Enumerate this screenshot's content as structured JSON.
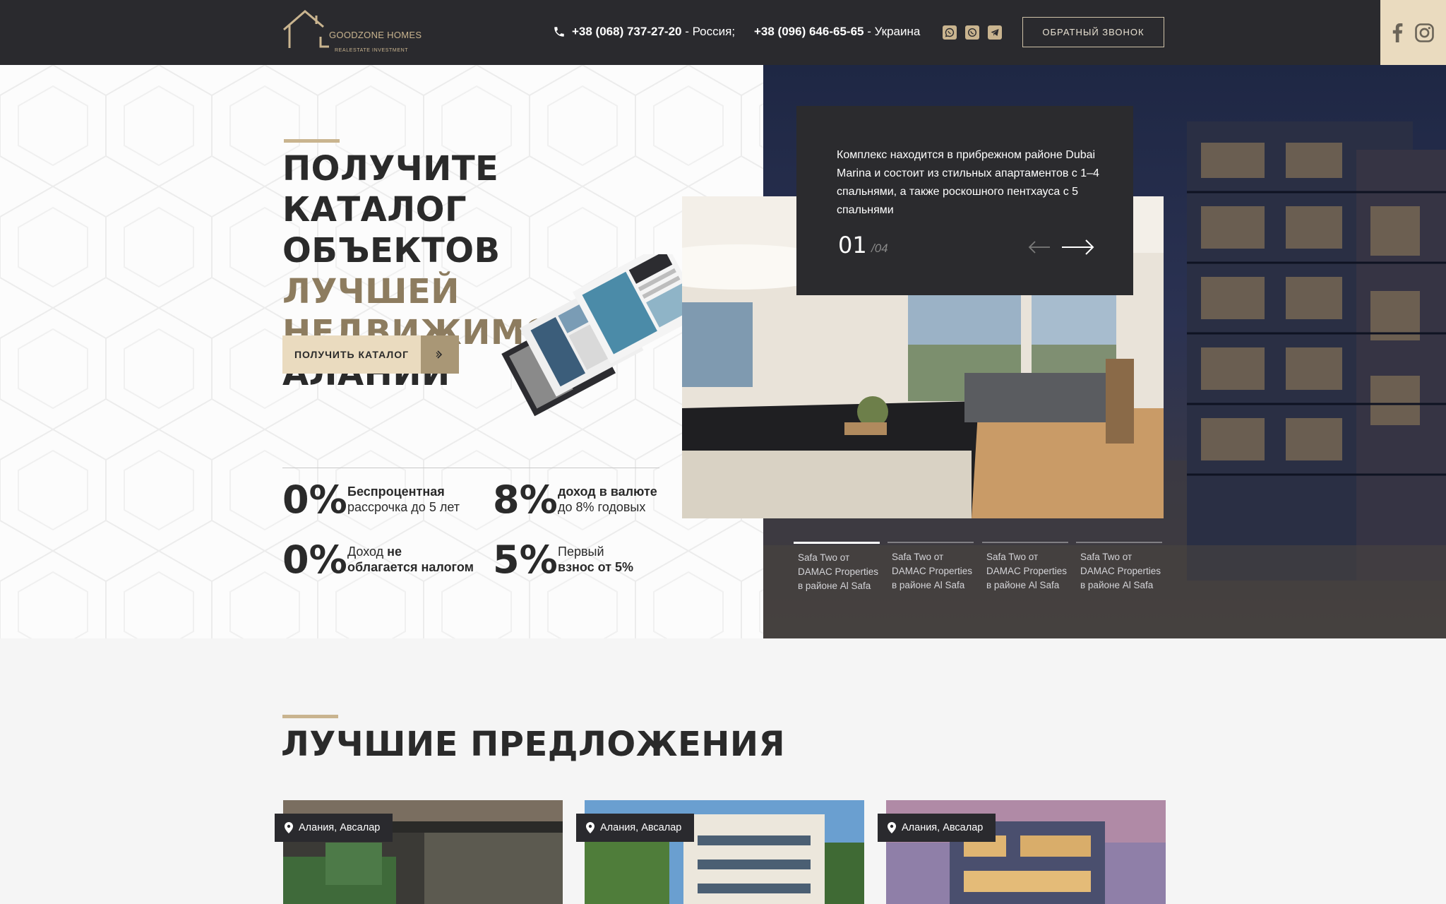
{
  "header": {
    "logo_name": "GOODZONE HOMES",
    "logo_sub": "REALESTATE INVESTMENT",
    "phone1": "+38 (068) 737-27-20",
    "phone1_suffix": " - Россия;",
    "phone2": "+38 (096) 646-65-65",
    "phone2_suffix": " - Украина",
    "messengers": [
      "viber-icon",
      "whatsapp-icon",
      "telegram-icon"
    ],
    "callback_label": "ОБРАТНЫЙ ЗВОНОК",
    "socials": [
      "facebook-icon",
      "instagram-icon"
    ]
  },
  "hero": {
    "title_line1": "ПОЛУЧИТЕ КАТАЛОГ",
    "title_line2a": "ОБЪЕКТОВ ",
    "title_line2b": "ЛУЧШЕЙ",
    "title_line3": "НЕДВИЖИМОСТИ",
    "title_line4": "АЛАНИИ",
    "catalog_button": "ПОЛУЧИТЬ КАТАЛОГ",
    "stats": [
      {
        "num": "0%",
        "line1": "Беспроцентная",
        "line2": "рассрочка до 5 лет"
      },
      {
        "num": "8%",
        "line1": "доход в валюте",
        "line2": "до 8% годовых"
      },
      {
        "num": "0%",
        "line1_a": "Доход ",
        "line1_b": "не",
        "line2": "облагается налогом"
      },
      {
        "num": "5%",
        "line1": "Первый",
        "line2": "взнос от 5%"
      }
    ]
  },
  "slider": {
    "description": "Комплекс находится в прибрежном районе Dubai Marina и состоит из стильных апартаментов с 1–4 спальнями, а также роскошного пентхауса с 5 спальнями",
    "current": "01",
    "total": "/04",
    "tabs": [
      {
        "line1": "Safa Two от",
        "line2": "DAMAC Properties",
        "line3": "в районе Al Safa"
      },
      {
        "line1": "Safa Two от",
        "line2": "DAMAC Properties",
        "line3": "в районе Al Safa"
      },
      {
        "line1": "Safa Two от",
        "line2": "DAMAC Properties",
        "line3": "в районе Al Safa"
      },
      {
        "line1": "Safa Two от",
        "line2": "DAMAC Properties",
        "line3": "в районе Al Safa"
      }
    ]
  },
  "offers": {
    "title": "ЛУЧШИЕ ПРЕДЛОЖЕНИЯ",
    "cards": [
      {
        "location": "Алания, Авсалар"
      },
      {
        "location": "Алания, Авсалар"
      },
      {
        "location": "Алания, Авсалар"
      }
    ]
  },
  "colors": {
    "header_bg": "#2a2a2e",
    "accent_gold": "#c9b48f",
    "accent_beige": "#eadbbf",
    "title_gold": "#8d7c5f",
    "dark_card": "#2b2b2e"
  }
}
